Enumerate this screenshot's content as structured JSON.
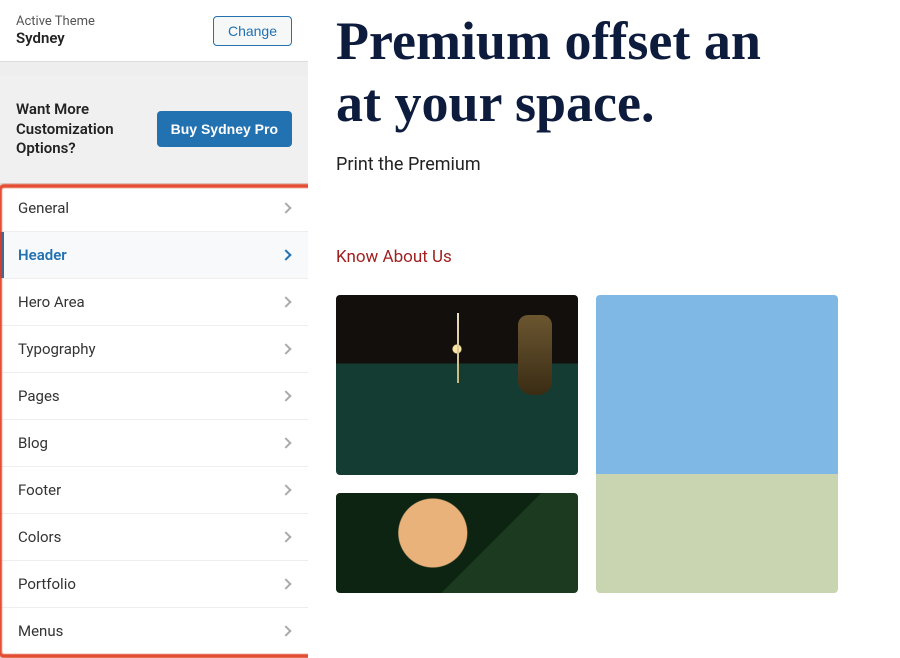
{
  "theme": {
    "label": "Active Theme",
    "name": "Sydney",
    "change_button": "Change"
  },
  "upsell": {
    "text": "Want More Customization Options?",
    "button": "Buy Sydney Pro"
  },
  "menu": {
    "items": [
      {
        "label": "General",
        "active": false
      },
      {
        "label": "Header",
        "active": true
      },
      {
        "label": "Hero Area",
        "active": false
      },
      {
        "label": "Typography",
        "active": false
      },
      {
        "label": "Pages",
        "active": false
      },
      {
        "label": "Blog",
        "active": false
      },
      {
        "label": "Footer",
        "active": false
      },
      {
        "label": "Colors",
        "active": false
      },
      {
        "label": "Portfolio",
        "active": false
      },
      {
        "label": "Menus",
        "active": false
      }
    ]
  },
  "preview": {
    "title_line1": "Premium offset an",
    "title_line2": "at your space.",
    "subtitle": "Print the Premium",
    "link": "Know About Us"
  }
}
